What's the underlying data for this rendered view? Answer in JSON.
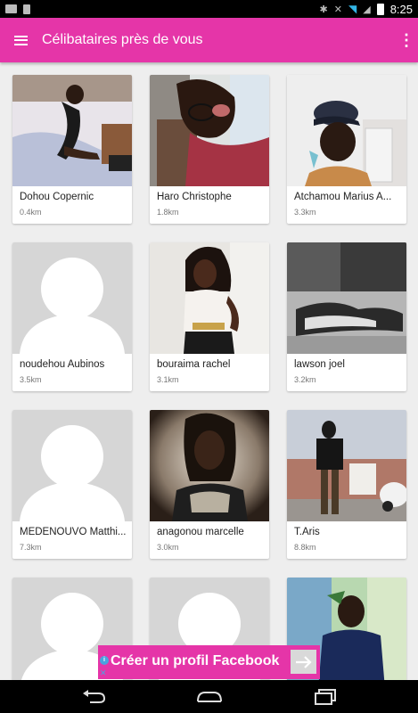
{
  "status_bar": {
    "time": "8:25",
    "icons": [
      "mail-icon",
      "document-icon",
      "bluetooth-icon",
      "mute-icon",
      "wifi-icon",
      "signal-icon",
      "battery-icon"
    ]
  },
  "app_bar": {
    "title": "Célibataires près de vous",
    "menu_icon": "menu-icon",
    "overflow_icon": "more-vert-icon"
  },
  "profiles": [
    {
      "name": "Dohou Copernic",
      "distance": "0.4km",
      "photo": "photo"
    },
    {
      "name": "Haro Christophe",
      "distance": "1.8km",
      "photo": "photo"
    },
    {
      "name": "Atchamou Marius A...",
      "distance": "3.3km",
      "photo": "photo"
    },
    {
      "name": "noudehou Aubinos",
      "distance": "3.5km",
      "photo": "placeholder"
    },
    {
      "name": "bouraima rachel",
      "distance": "3.1km",
      "photo": "photo"
    },
    {
      "name": "lawson joel",
      "distance": "3.2km",
      "photo": "photo"
    },
    {
      "name": "MEDENOUVO Matthi...",
      "distance": "7.3km",
      "photo": "placeholder"
    },
    {
      "name": "anagonou marcelle",
      "distance": "3.0km",
      "photo": "photo"
    },
    {
      "name": "T.Aris",
      "distance": "8.8km",
      "photo": "photo"
    },
    {
      "name": "",
      "distance": "",
      "photo": "placeholder"
    },
    {
      "name": "",
      "distance": "",
      "photo": "placeholder"
    },
    {
      "name": "",
      "distance": "",
      "photo": "photo"
    }
  ],
  "ad_banner": {
    "text": "Créer un profil Facebook",
    "info_icon": "info-icon",
    "close_icon": "close-icon",
    "arrow_icon": "arrow-right-icon"
  },
  "nav_bar": {
    "buttons": [
      "back-icon",
      "home-icon",
      "recents-icon"
    ]
  },
  "colors": {
    "accent": "#e535a8",
    "placeholder_bg": "#d6d6d6"
  }
}
